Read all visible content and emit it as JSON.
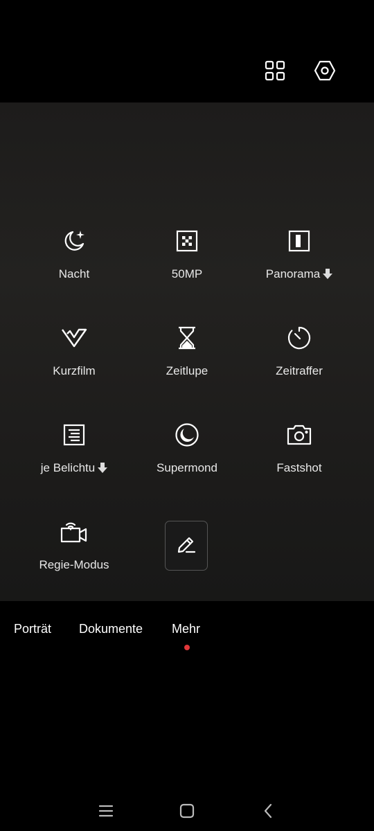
{
  "top_bar": {
    "icons": [
      "grid-icon",
      "settings-hexagon-icon"
    ]
  },
  "modes": [
    {
      "label": "Nacht",
      "icon": "night-moon-icon",
      "download": false
    },
    {
      "label": "50MP",
      "icon": "50mp-icon",
      "download": false
    },
    {
      "label": "Panorama",
      "icon": "panorama-icon",
      "download": true
    },
    {
      "label": "Kurzfilm",
      "icon": "kurzfilm-icon",
      "download": false
    },
    {
      "label": "Zeitlupe",
      "icon": "hourglass-icon",
      "download": false
    },
    {
      "label": "Zeitraffer",
      "icon": "timer-icon",
      "download": false
    },
    {
      "label": "je Belichtu",
      "icon": "long-exposure-icon",
      "download": true
    },
    {
      "label": "Supermond",
      "icon": "supermoon-icon",
      "download": false
    },
    {
      "label": "Fastshot",
      "icon": "camera-icon",
      "download": false
    },
    {
      "label": "Regie-Modus",
      "icon": "director-mode-icon",
      "download": false
    }
  ],
  "edit_button": {
    "icon": "pencil-icon"
  },
  "mode_tabs": {
    "items": [
      "Porträt",
      "Dokumente",
      "Mehr"
    ],
    "active": "Mehr",
    "active_dot_color": "#e0373a"
  },
  "nav_bar": {
    "icons": [
      "menu-icon",
      "home-icon",
      "back-icon"
    ]
  }
}
